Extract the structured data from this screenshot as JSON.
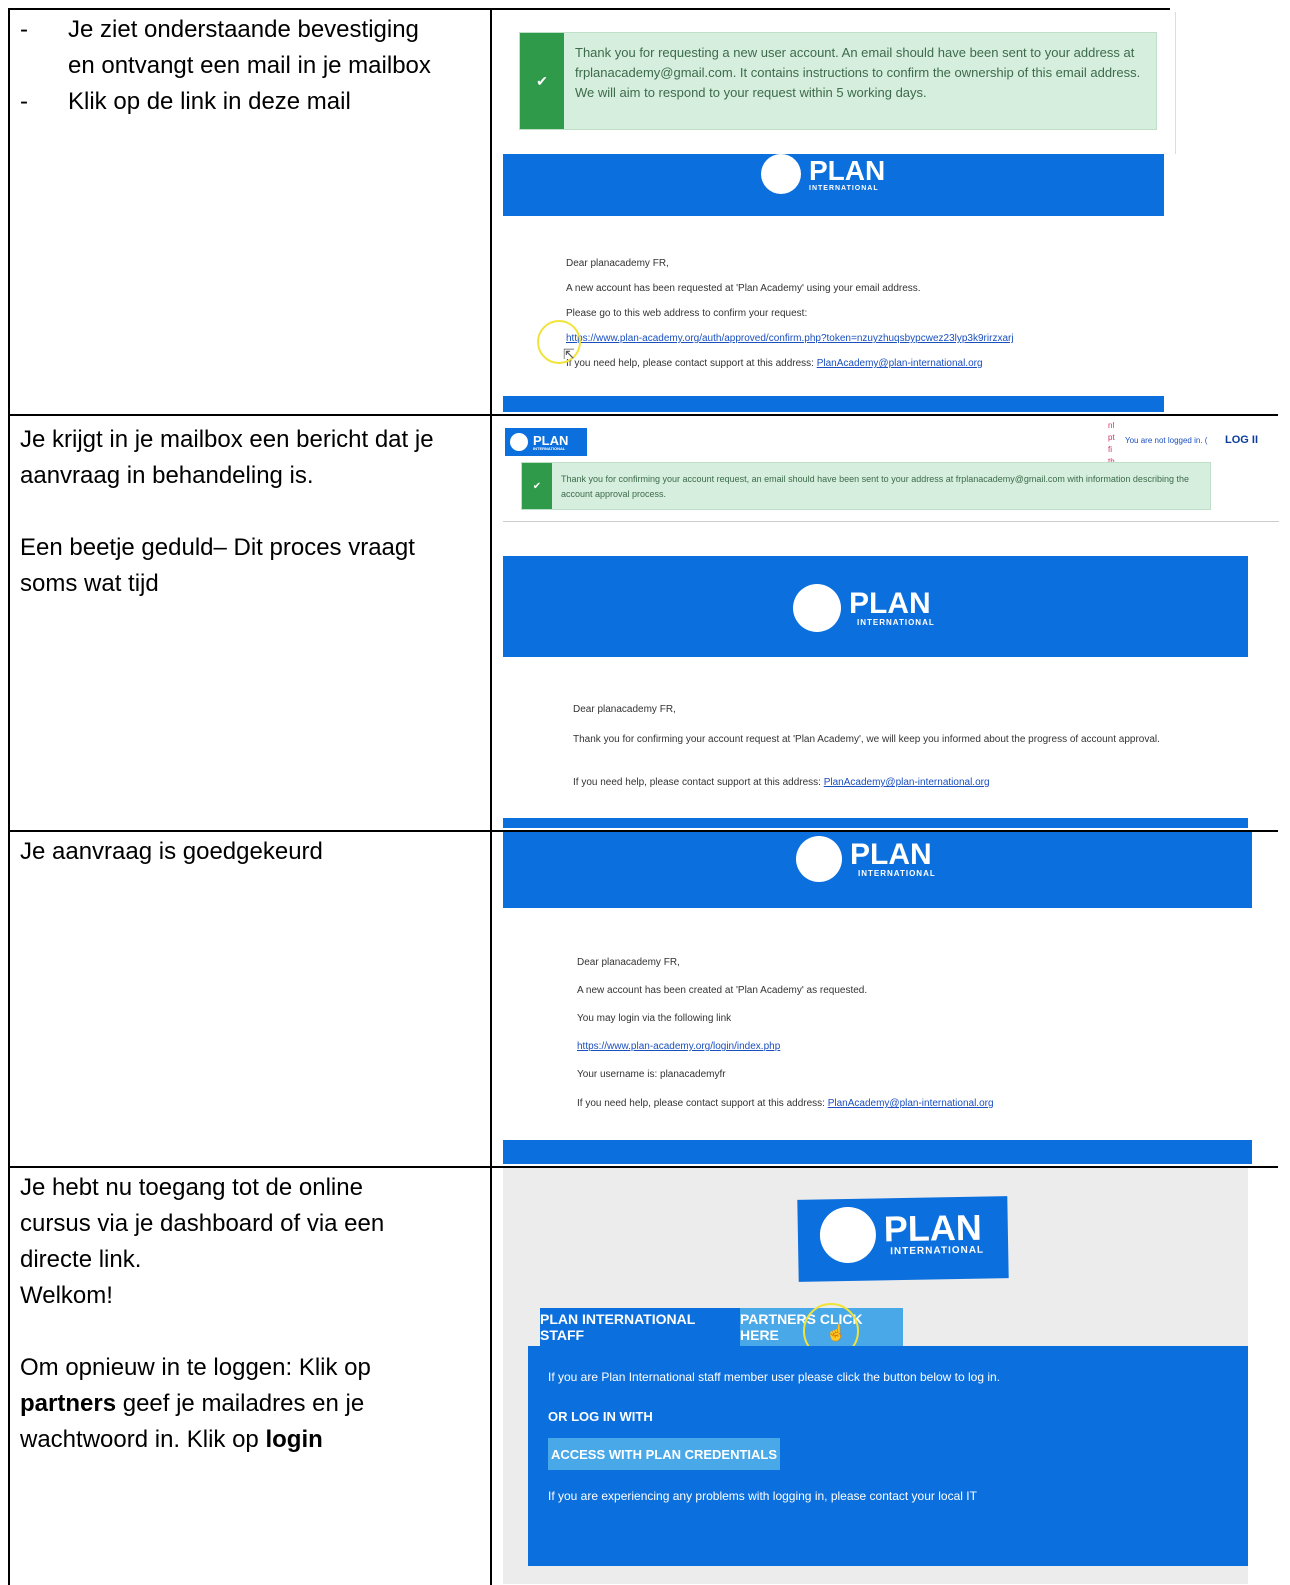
{
  "rows": [
    {
      "instructions": [
        {
          "bullet": "-",
          "text": "Je ziet onderstaande bevestiging en ontvangt een mail in je mailbox"
        },
        {
          "bullet": "-",
          "text": "Klik op de link in deze mail"
        }
      ],
      "alert": "Thank you for requesting a new user account. An email should have been sent to your address at frplanacademy@gmail.com. It contains instructions to confirm the ownership of this email address. We will aim to respond to your request within 5 working days.",
      "email": {
        "greeting": "Dear planacademy FR,",
        "line1": "A new account has been requested at 'Plan Academy' using your email address.",
        "line2": "Please go to this web address to confirm your request:",
        "link": "https://www.plan-academy.org/auth/approved/confirm.php?token=nzuyzhuqsbypcwez23lyp3k9rirzxarj",
        "help_prefix": "If you need help, please contact support at this address:",
        "help_link": "PlanAcademy@plan-international.org"
      }
    },
    {
      "para1": "Je krijgt in je mailbox een bericht dat je aanvraag in behandeling is.",
      "para2": "Een beetje geduld– Dit proces vraagt soms wat tijd",
      "header_status": "You are not logged in. (",
      "header_login": "LOG II",
      "lang_codes": [
        "nl",
        "pt",
        "fi",
        "th",
        "zh"
      ],
      "alert": "Thank you for confirming your account request, an email should have been sent to your address at frplanacademy@gmail.com with information describing the account approval process.",
      "email": {
        "greeting": "Dear planacademy FR,",
        "line1": "Thank you for confirming your account request at 'Plan Academy', we will keep you informed about the progress of account approval.",
        "help_prefix": "If you need help, please contact support at this address:",
        "help_link": "PlanAcademy@plan-international.org"
      }
    },
    {
      "para1": "Je aanvraag is goedgekeurd",
      "email": {
        "greeting": "Dear planacademy FR,",
        "line1": "A new account has been created at 'Plan Academy' as requested.",
        "line2": "You may login via the following link",
        "link": "https://www.plan-academy.org/login/index.php",
        "line3": "Your username is: planacademyfr",
        "help_prefix": "If you need help, please contact support at this address:",
        "help_link": "PlanAcademy@plan-international.org"
      }
    },
    {
      "para1": "Je hebt nu toegang tot de online cursus via je dashboard of via  een directe link.",
      "para2": "Welkom!",
      "para3_a": "Om opnieuw in te loggen: Klik op ",
      "para3_b": "partners",
      "para3_c": " geef je mailadres en je wachtwoord in. Klik op ",
      "para3_d": "login",
      "tab_staff": "PLAN INTERNATIONAL STAFF",
      "tab_partners": "PARTNERS CLICK HERE",
      "staff_text": "If you are Plan International staff member user please click the button below to log in.",
      "or_login": "OR LOG IN WITH",
      "access_button": "ACCESS WITH PLAN CREDENTIALS",
      "problems_text": "If you are experiencing any problems with logging in, please contact your local IT"
    }
  ],
  "logo": {
    "word": "PLAN",
    "sub": "INTERNATIONAL"
  },
  "colors": {
    "plan_blue": "#0b6fde",
    "alert_green": "#d5eedd",
    "check_green": "#2e9a4a",
    "highlight_yellow": "#f2e33a"
  }
}
